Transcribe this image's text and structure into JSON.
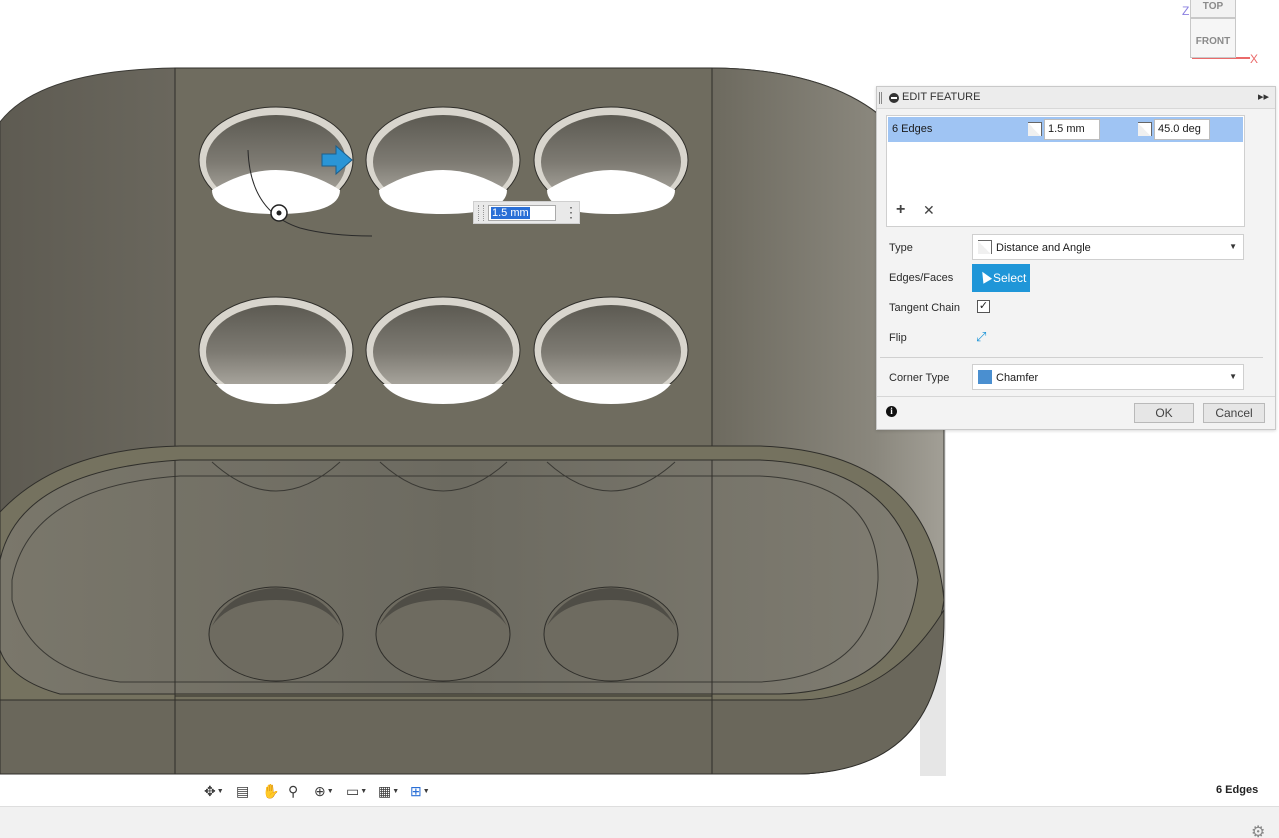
{
  "viewcube": {
    "top_label": "TOP",
    "front_label": "FRONT",
    "z_axis": "Z",
    "x_axis": "X"
  },
  "canvas": {
    "distance_value": "1.5 mm"
  },
  "panel": {
    "title": "EDIT FEATURE",
    "edge_row": {
      "label": "6 Edges",
      "distance": "1.5 mm",
      "angle": "45.0 deg"
    },
    "type_label": "Type",
    "type_value": "Distance and Angle",
    "edges_label": "Edges/Faces",
    "select_label": "Select",
    "tangent_label": "Tangent Chain",
    "tangent_checked": true,
    "flip_label": "Flip",
    "corner_label": "Corner Type",
    "corner_value": "Chamfer",
    "ok_label": "OK",
    "cancel_label": "Cancel"
  },
  "toolbar": {
    "items": [
      "orbit-icon",
      "look-at-icon",
      "pan-icon",
      "zoom-icon",
      "fit-icon",
      "display-settings-icon",
      "grid-icon",
      "viewports-icon"
    ]
  },
  "status": {
    "selection_text": "6 Edges"
  },
  "colors": {
    "select_blue": "#1f96d8",
    "row_highlight": "#9fc4f3",
    "model_gray": "#6b675c"
  }
}
